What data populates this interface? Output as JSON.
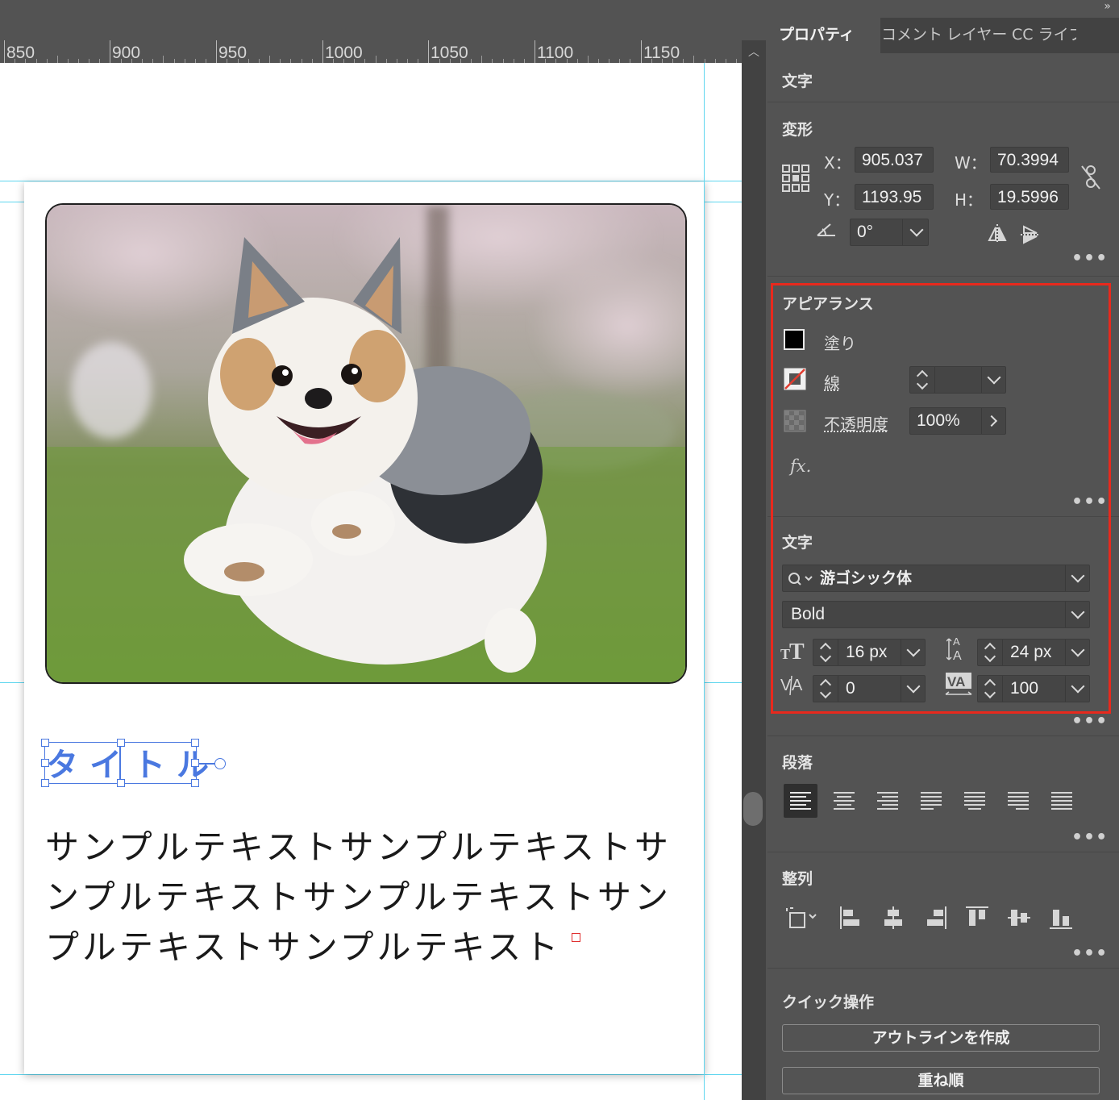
{
  "ruler": {
    "labels": [
      "850",
      "900",
      "950",
      "1000",
      "1050",
      "1100",
      "1150"
    ]
  },
  "document": {
    "title_text": "タイトル",
    "body_text": "サンプルテキストサンプルテキストサンプルテキストサンプルテキストサンプルテキストサンプルテキスト",
    "image_subject": "running-chihuahua-photo"
  },
  "panel": {
    "collapse_glyph": "»",
    "tabs": [
      {
        "label": "プロパティ",
        "active": true
      },
      {
        "label": "コメント",
        "active": false
      },
      {
        "label": "レイヤー",
        "active": false
      },
      {
        "label": "CC ライブラリ",
        "active": false
      }
    ],
    "object_type": "文字",
    "transform": {
      "title": "変形",
      "x_label": "X：",
      "x_value": "905.037",
      "y_label": "Y：",
      "y_value": "1193.95",
      "w_label": "W：",
      "w_value": "70.3994",
      "h_label": "H：",
      "h_value": "19.5996",
      "rotate_value": "0°"
    },
    "appearance": {
      "title": "アピアランス",
      "fill_label": "塗り",
      "fill_color": "#000000",
      "stroke_label": "線",
      "stroke_value": "",
      "opacity_label": "不透明度",
      "opacity_value": "100%",
      "fx_label": "fx."
    },
    "character": {
      "title": "文字",
      "font_family": "游ゴシック体",
      "font_style": "Bold",
      "font_size": "16 px",
      "leading": "24 px",
      "kerning": "0",
      "tracking": "100"
    },
    "paragraph": {
      "title": "段落"
    },
    "align": {
      "title": "整列"
    },
    "quick_actions": {
      "title": "クイック操作",
      "create_outlines": "アウトラインを作成",
      "arrange": "重ね順"
    }
  },
  "colors": {
    "panel_bg": "#535353",
    "highlight_box": "#e8291d",
    "selection": "#4a78e0",
    "guide": "#5fd6ef"
  }
}
